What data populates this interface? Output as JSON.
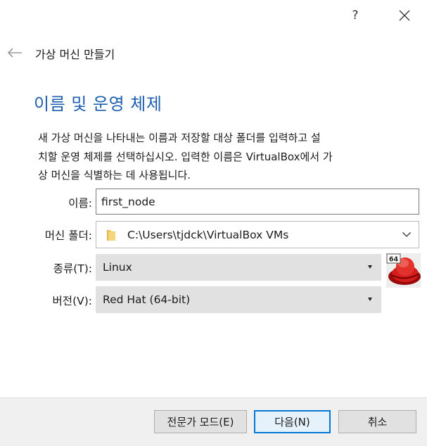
{
  "titlebar": {
    "help_label": "?"
  },
  "header": {
    "title": "가상 머신 만들기"
  },
  "section": {
    "heading": "이름 및 운영 체제",
    "description_lines": [
      "새 가상 머신을 나타내는 이름과 저장할 대상 폴더를 입력하고 설",
      "치할 운영 체제를 선택하십시오. 입력한 이름은 VirtualBox에서 가",
      "상 머신을 식별하는 데 사용됩니다."
    ]
  },
  "form": {
    "name_label": "이름:",
    "name_value": "first_node",
    "folder_label": "머신 폴더:",
    "folder_value": "C:\\Users\\tjdck\\VirtualBox VMs",
    "type_label": "종류(T):",
    "type_value": "Linux",
    "version_label": "버전(V):",
    "version_value": "Red Hat (64-bit)",
    "os_icon_badge": "64"
  },
  "footer": {
    "expert_mode_label": "전문가 모드(E)",
    "next_label": "다음(N)",
    "cancel_label": "취소"
  }
}
